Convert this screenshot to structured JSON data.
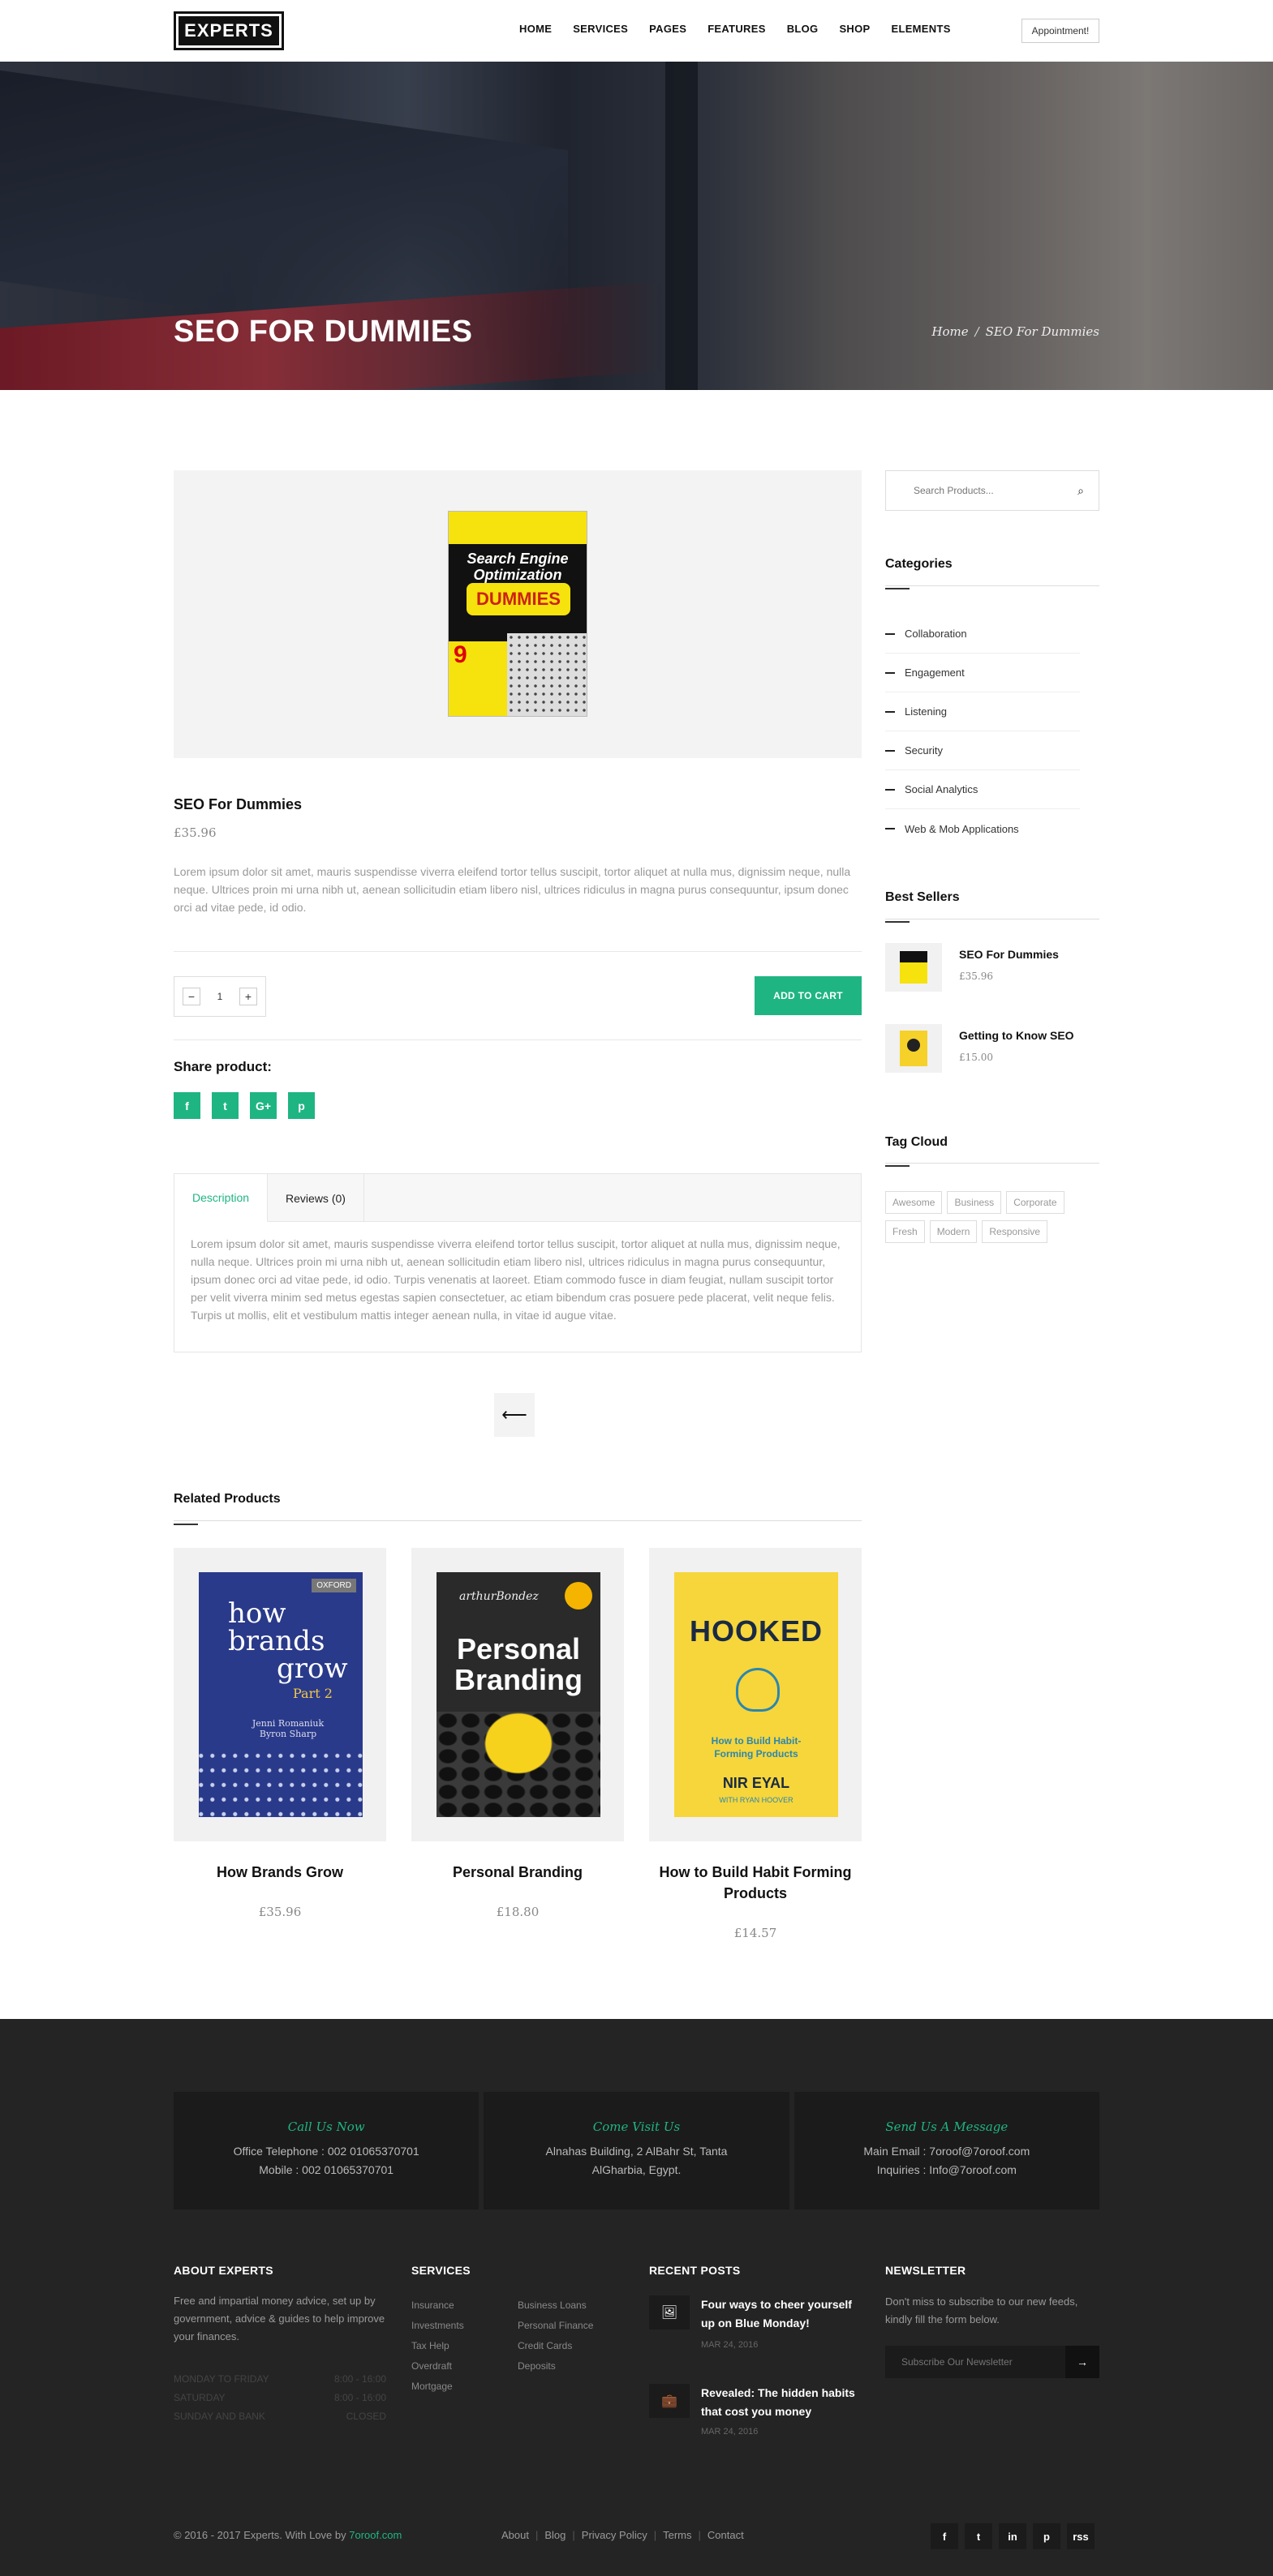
{
  "header": {
    "logo": "EXPERTS",
    "nav": [
      "HOME",
      "SERVICES",
      "PAGES",
      "FEATURES",
      "BLOG",
      "SHOP",
      "ELEMENTS"
    ],
    "appointment": "Appointment!"
  },
  "hero": {
    "title": "SEO FOR DUMMIES",
    "breadcrumb": {
      "home": "Home",
      "sep": "/",
      "current": "SEO For Dummies"
    }
  },
  "product": {
    "cover": {
      "title": "Search Engine Optimization",
      "subtitle": "DUMMIES",
      "badge": "9"
    },
    "name": "SEO For Dummies",
    "price": "£35.96",
    "description": "Lorem ipsum dolor sit amet, mauris suspendisse viverra eleifend tortor tellus suscipit, tortor aliquet at nulla mus, dignissim neque, nulla neque. Ultrices proin mi urna nibh ut, aenean sollicitudin etiam libero nisl, ultrices ridiculus in magna purus consequuntur, ipsum donec orci ad vitae pede, id odio.",
    "qty": {
      "minus": "−",
      "value": "1",
      "plus": "+"
    },
    "add_to_cart": "ADD TO CART",
    "share_label": "Share product:",
    "share": [
      {
        "icon": "facebook-icon",
        "glyph": "f"
      },
      {
        "icon": "twitter-icon",
        "glyph": "t"
      },
      {
        "icon": "google-plus-icon",
        "glyph": "G+"
      },
      {
        "icon": "pinterest-icon",
        "glyph": "p"
      }
    ]
  },
  "tabs": {
    "items": [
      "Description",
      "Reviews (0)"
    ],
    "active": 0,
    "text": "Lorem ipsum dolor sit amet, mauris suspendisse viverra eleifend tortor tellus suscipit, tortor aliquet at nulla mus, dignissim neque, nulla neque. Ultrices proin mi urna nibh ut, aenean sollicitudin etiam libero nisl, ultrices ridiculus in magna purus consequuntur, ipsum donec orci ad vitae pede, id odio. Turpis venenatis at laoreet. Etiam commodo fusce in diam feugiat, nullam suscipit tortor per velit viverra minim sed metus egestas sapien consectetuer, ac etiam bibendum cras posuere pede placerat, velit neque felis. Turpis ut mollis, elit et vestibulum mattis integer aenean nulla, in vitae id augue vitae."
  },
  "back_arrow": "⟵",
  "related": {
    "heading": "Related Products",
    "items": [
      {
        "title": "How Brands Grow",
        "price": "£35.96",
        "cover": {
          "line1": "how",
          "line2": "brands",
          "line3": "grow",
          "part": "Part 2",
          "authors": "Jenni Romaniuk Byron Sharp",
          "pub": "OXFORD"
        }
      },
      {
        "title": "Personal Branding",
        "price": "£18.80",
        "cover": {
          "top": "arthurBondez",
          "line1": "Personal",
          "line2": "Branding"
        }
      },
      {
        "title": "How to Build Habit Forming Products",
        "price": "£14.57",
        "cover": {
          "line1": "HOOKED",
          "sub": "How to Build Habit-Forming Products",
          "author": "NIR EYAL",
          "with": "WITH RYAN HOOVER"
        }
      }
    ]
  },
  "sidebar": {
    "search_placeholder": "Search Products...",
    "search_icon": "⌕",
    "categories_heading": "Categories",
    "categories": [
      "Collaboration",
      "Engagement",
      "Listening",
      "Security",
      "Social Analytics",
      "Web & Mob Applications"
    ],
    "best_heading": "Best Sellers",
    "best": [
      {
        "title": "SEO For Dummies",
        "price": "£35.96"
      },
      {
        "title": "Getting to Know SEO",
        "price": "£15.00"
      }
    ],
    "tags_heading": "Tag Cloud",
    "tags": [
      "Awesome",
      "Business",
      "Corporate",
      "Fresh",
      "Modern",
      "Responsive"
    ]
  },
  "footer": {
    "contact": [
      {
        "heading": "Call Us Now",
        "lines": [
          "Office Telephone : 002 01065370701",
          "Mobile : 002 01065370701"
        ]
      },
      {
        "heading": "Come Visit Us",
        "lines": [
          "Alnahas Building, 2 AlBahr St, Tanta",
          "AlGharbia, Egypt."
        ]
      },
      {
        "heading": "Send Us A Message",
        "lines": [
          "Main Email : 7oroof@7oroof.com",
          "Inquiries : Info@7oroof.com"
        ]
      }
    ],
    "about_heading": "ABOUT EXPERTS",
    "about_text": "Free and impartial money advice, set up by government, advice & guides to help improve your finances.",
    "hours": [
      {
        "day": "MONDAY TO FRIDAY",
        "time": "8:00 - 16:00"
      },
      {
        "day": "SATURDAY",
        "time": "8:00 - 16:00"
      },
      {
        "day": "SUNDAY AND BANK",
        "time": "CLOSED"
      }
    ],
    "services_heading": "SERVICES",
    "services_col1": [
      "Insurance",
      "Investments",
      "Tax Help",
      "Overdraft",
      "Mortgage"
    ],
    "services_col2": [
      "Business Loans",
      "Personal Finance",
      "Credit Cards",
      "Deposits"
    ],
    "posts_heading": "RECENT POSTS",
    "posts": [
      {
        "title": "Four ways to cheer yourself up on Blue Monday!",
        "date": "MAR 24, 2016",
        "icon": "🖼"
      },
      {
        "title": "Revealed: The hidden habits that cost you money",
        "date": "MAR 24, 2016",
        "icon": "💼"
      }
    ],
    "newsletter_heading": "NEWSLETTER",
    "newsletter_text": "Don't miss to subscribe to our new feeds, kindly fill the form below.",
    "newsletter_placeholder": "Subscribe Our Newsletter",
    "newsletter_go": "→",
    "copyright": "© 2016 - 2017 Experts. With Love by ",
    "copyright_link": "7oroof.com",
    "links": [
      "About",
      "Blog",
      "Privacy Policy",
      "Terms",
      "Contact"
    ],
    "social": [
      {
        "icon": "facebook-icon",
        "glyph": "f"
      },
      {
        "icon": "twitter-icon",
        "glyph": "t"
      },
      {
        "icon": "linkedin-icon",
        "glyph": "in"
      },
      {
        "icon": "pinterest-icon",
        "glyph": "p"
      },
      {
        "icon": "rss-icon",
        "glyph": "rss"
      }
    ]
  },
  "colors": {
    "accent": "#1fb582",
    "footer_bg": "#242424",
    "footer_box": "#1b1b1b"
  }
}
